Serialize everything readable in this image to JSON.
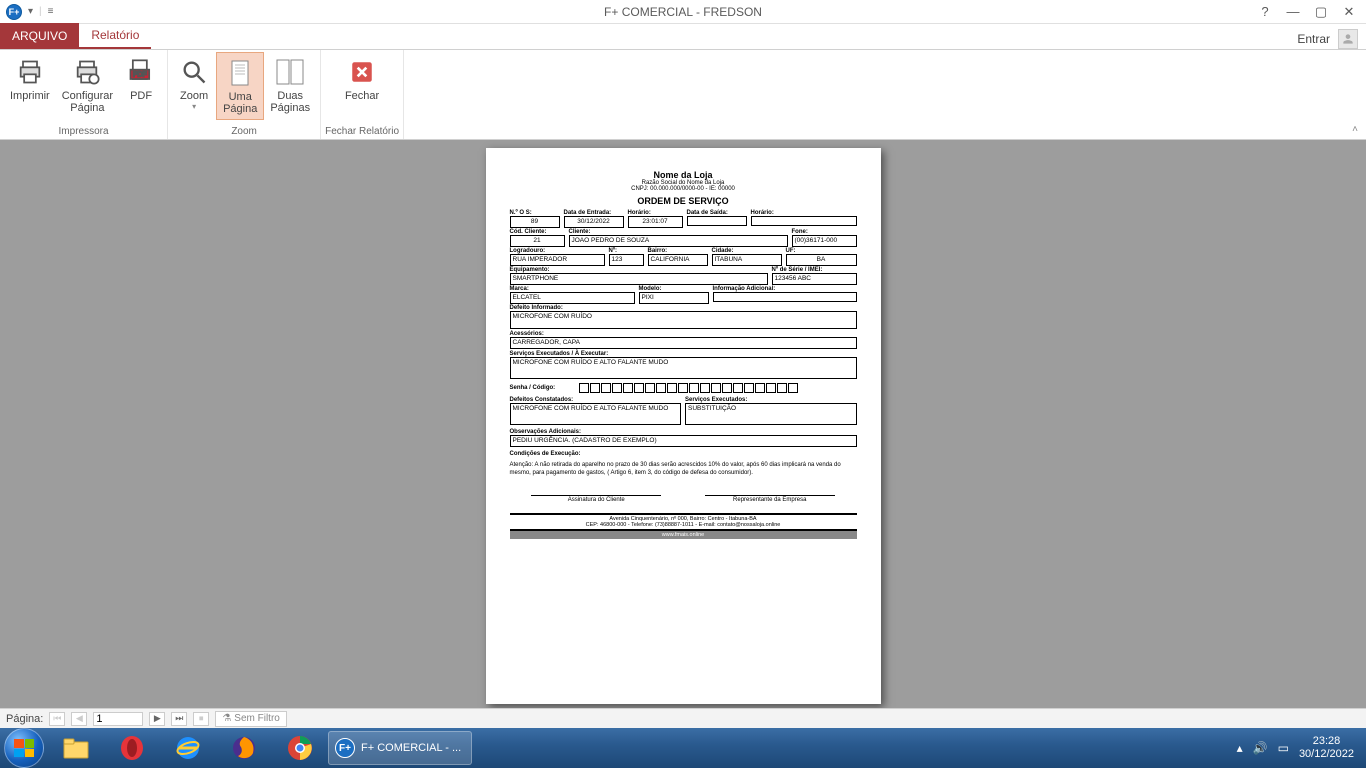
{
  "titlebar": {
    "app_title": "F+ COMERCIAL - FREDSON",
    "entrar": "Entrar"
  },
  "tabs": {
    "file": "ARQUIVO",
    "report": "Relatório"
  },
  "ribbon": {
    "imprimir": "Imprimir",
    "configurar": "Configurar\nPágina",
    "pdf": "PDF",
    "impressora_group": "Impressora",
    "zoom": "Zoom",
    "uma": "Uma\nPágina",
    "duas": "Duas\nPáginas",
    "zoom_group": "Zoom",
    "fechar": "Fechar",
    "fechar_group": "Fechar Relatório"
  },
  "statusbar": {
    "pagina_label": "Página:",
    "page_value": "1",
    "sem_filtro": "Sem Filtro"
  },
  "taskbar": {
    "app_label": "F+ COMERCIAL - ...",
    "time": "23:28",
    "date": "30/12/2022"
  },
  "report": {
    "store_name": "Nome da Loja",
    "store_sub": "Razão Social do Nome da Loja",
    "store_cnpj": "CNPJ: 00.000.000/0000-00 - IE: 00000",
    "title": "ORDEM DE SERVIÇO",
    "labels": {
      "os": "N.º O S:",
      "data_entrada": "Data de Entrada:",
      "horario": "Horário:",
      "data_saida": "Data de Saída:",
      "horario2": "Horário:",
      "cod_cliente": "Cód. Cliente:",
      "cliente": "Cliente:",
      "fone": "Fone:",
      "logradouro": "Logradouro:",
      "numero": "Nº:",
      "bairro": "Bairro:",
      "cidade": "Cidade:",
      "uf": "UF:",
      "equipamento": "Equipamento:",
      "serie": "Nº de Série / IMEI:",
      "marca": "Marca:",
      "modelo": "Modelo:",
      "info_ad": "Informação Adicional:",
      "defeito_inf": "Defeito Informado:",
      "acessorios": "Acessórios:",
      "servicos_exec": "Serviços Executados / À Executar:",
      "senha": "Senha / Código:",
      "defeitos_const": "Defeitos Constatados:",
      "servicos_exec2": "Serviços Executados:",
      "obs": "Observações Adicionais:",
      "condicoes": "Condições de Execução:",
      "assinatura_cliente": "Assinatura do Cliente",
      "representante": "Representante da Empresa"
    },
    "values": {
      "os": "89",
      "data_entrada": "30/12/2022",
      "horario": "23:01:07",
      "data_saida": "",
      "horario2": "",
      "cod_cliente": "21",
      "cliente": "JOAO PEDRO DE SOUZA",
      "fone": "(00)36171-000",
      "logradouro": "RUA IMPERADOR",
      "numero": "123",
      "bairro": "CALIFORNIA",
      "cidade": "ITABUNA",
      "uf": "BA",
      "equipamento": "SMARTPHONE",
      "serie": "123456 ABC",
      "marca": "ELCATEL",
      "modelo": "PIXI",
      "info_ad": "",
      "defeito_inf": "MICROFONE COM RUÍDO",
      "acessorios": "CARREGADOR, CAPA",
      "servicos_exec": "MICROFONE COM RUÍDO E ALTO FALANTE MUDO",
      "defeitos_const": "MICROFONE COM RUÍDO E ALTO FALANTE MUDO",
      "servicos_exec2": "SUBSTITUIÇÃO",
      "obs": "PEDIU URGÊNCIA. (CADASTRO DE EXEMPLO)",
      "atencao": "Atenção: A não retirada do aparelho no prazo de 30 dias serão acrescidos 10% do valor, após 60 dias implicará na venda do mesmo, para pagamento de gastos, ( Artigo 6, item 3, do código de defesa do consumidor)."
    },
    "footer": {
      "line1": "Avenida Cinquentenário, nº 000, Bairro: Centro - Itabuna-BA",
      "line2": "CEP: 46800-000 - Telefone: (73)88887-1011 - E-mail: contato@nossaloja.online",
      "site": "www.fmais.online"
    }
  }
}
